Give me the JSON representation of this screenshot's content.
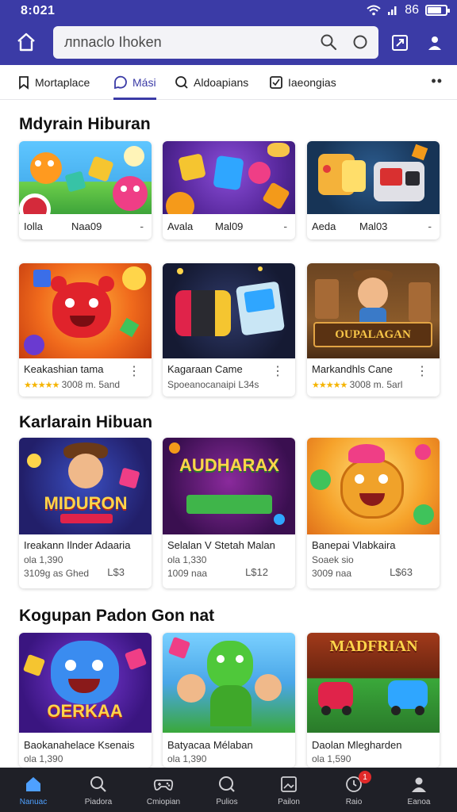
{
  "status": {
    "time": "8:021",
    "signal": "86"
  },
  "search": {
    "value": "лnnaclo Ihoken"
  },
  "tabs": [
    {
      "label": "Mortaplace",
      "icon": "bookmark-icon"
    },
    {
      "label": "Mási",
      "icon": "chat-icon"
    },
    {
      "label": "Aldoapians",
      "icon": "search-icon"
    },
    {
      "label": "Iaeongias",
      "icon": "checkbox-icon"
    }
  ],
  "sections": [
    {
      "title": "Mdyrain Hiburan",
      "cards": [
        {
          "t1": "Iolla",
          "t1b": "Naa09",
          "trail": "-"
        },
        {
          "t1": "Avala",
          "t1b": "Mal09",
          "trail": "-"
        },
        {
          "t1": "Aeda",
          "t1b": "Mal03",
          "trail": "-"
        },
        {
          "t1": "Keakashian tama",
          "rating": "★★★★★",
          "meta": "3008 m. 5and",
          "trail": "⋮"
        },
        {
          "t1": "Kagaraan Came",
          "meta": "Spoeanocanaipi  L34s",
          "trail": "⋮"
        },
        {
          "t1": "Markandhls Cane",
          "rating": "★★★★★",
          "meta": "3008 m. 5arl",
          "trail": "⋮"
        }
      ]
    },
    {
      "title": "Karlarain Hibuan",
      "cards": [
        {
          "t1": "Ireakann Ilnder Adaaria",
          "t2": "ola 1,390",
          "t3": "3109g as  Ghed",
          "price": "L$3",
          "art_text": "MIDURON"
        },
        {
          "t1": "Selalan V Stetah Malan",
          "t2": "ola 1,330",
          "t3": "1009 naa",
          "price": "L$12",
          "art_text": "AUDHARAX"
        },
        {
          "t1": "Banepai Vlabkaira",
          "t2": "Soaek sio",
          "t3": "3009 naa",
          "price": "L$63"
        }
      ]
    },
    {
      "title": "Kogupan Padon Gon nat",
      "cards": [
        {
          "t1": "Baokanahelace Ksenais",
          "t2": "ola 1,390",
          "art_text": "OERKAA"
        },
        {
          "t1": "Batyacaa Mélaban",
          "t2": "ola 1,390"
        },
        {
          "t1": "Daolan Mlegharden",
          "t2": "ola 1,590",
          "art_text": "MADFRIAN"
        }
      ]
    }
  ],
  "bottom_nav": [
    {
      "label": "Nanuac",
      "icon": "home-icon",
      "active": true
    },
    {
      "label": "Piadora",
      "icon": "search-icon"
    },
    {
      "label": "Cmiopian",
      "icon": "game-icon"
    },
    {
      "label": "Pulios",
      "icon": "search-alt-icon"
    },
    {
      "label": "Pailon",
      "icon": "image-icon"
    },
    {
      "label": "Raio",
      "icon": "clock-icon",
      "badge": "1"
    },
    {
      "label": "Eanoa",
      "icon": "user-icon"
    }
  ],
  "colors": {
    "accent": "#3b3ba6",
    "nav_bg": "#1f2027",
    "active_nav": "#4ea0ff",
    "star": "#f5b400"
  }
}
